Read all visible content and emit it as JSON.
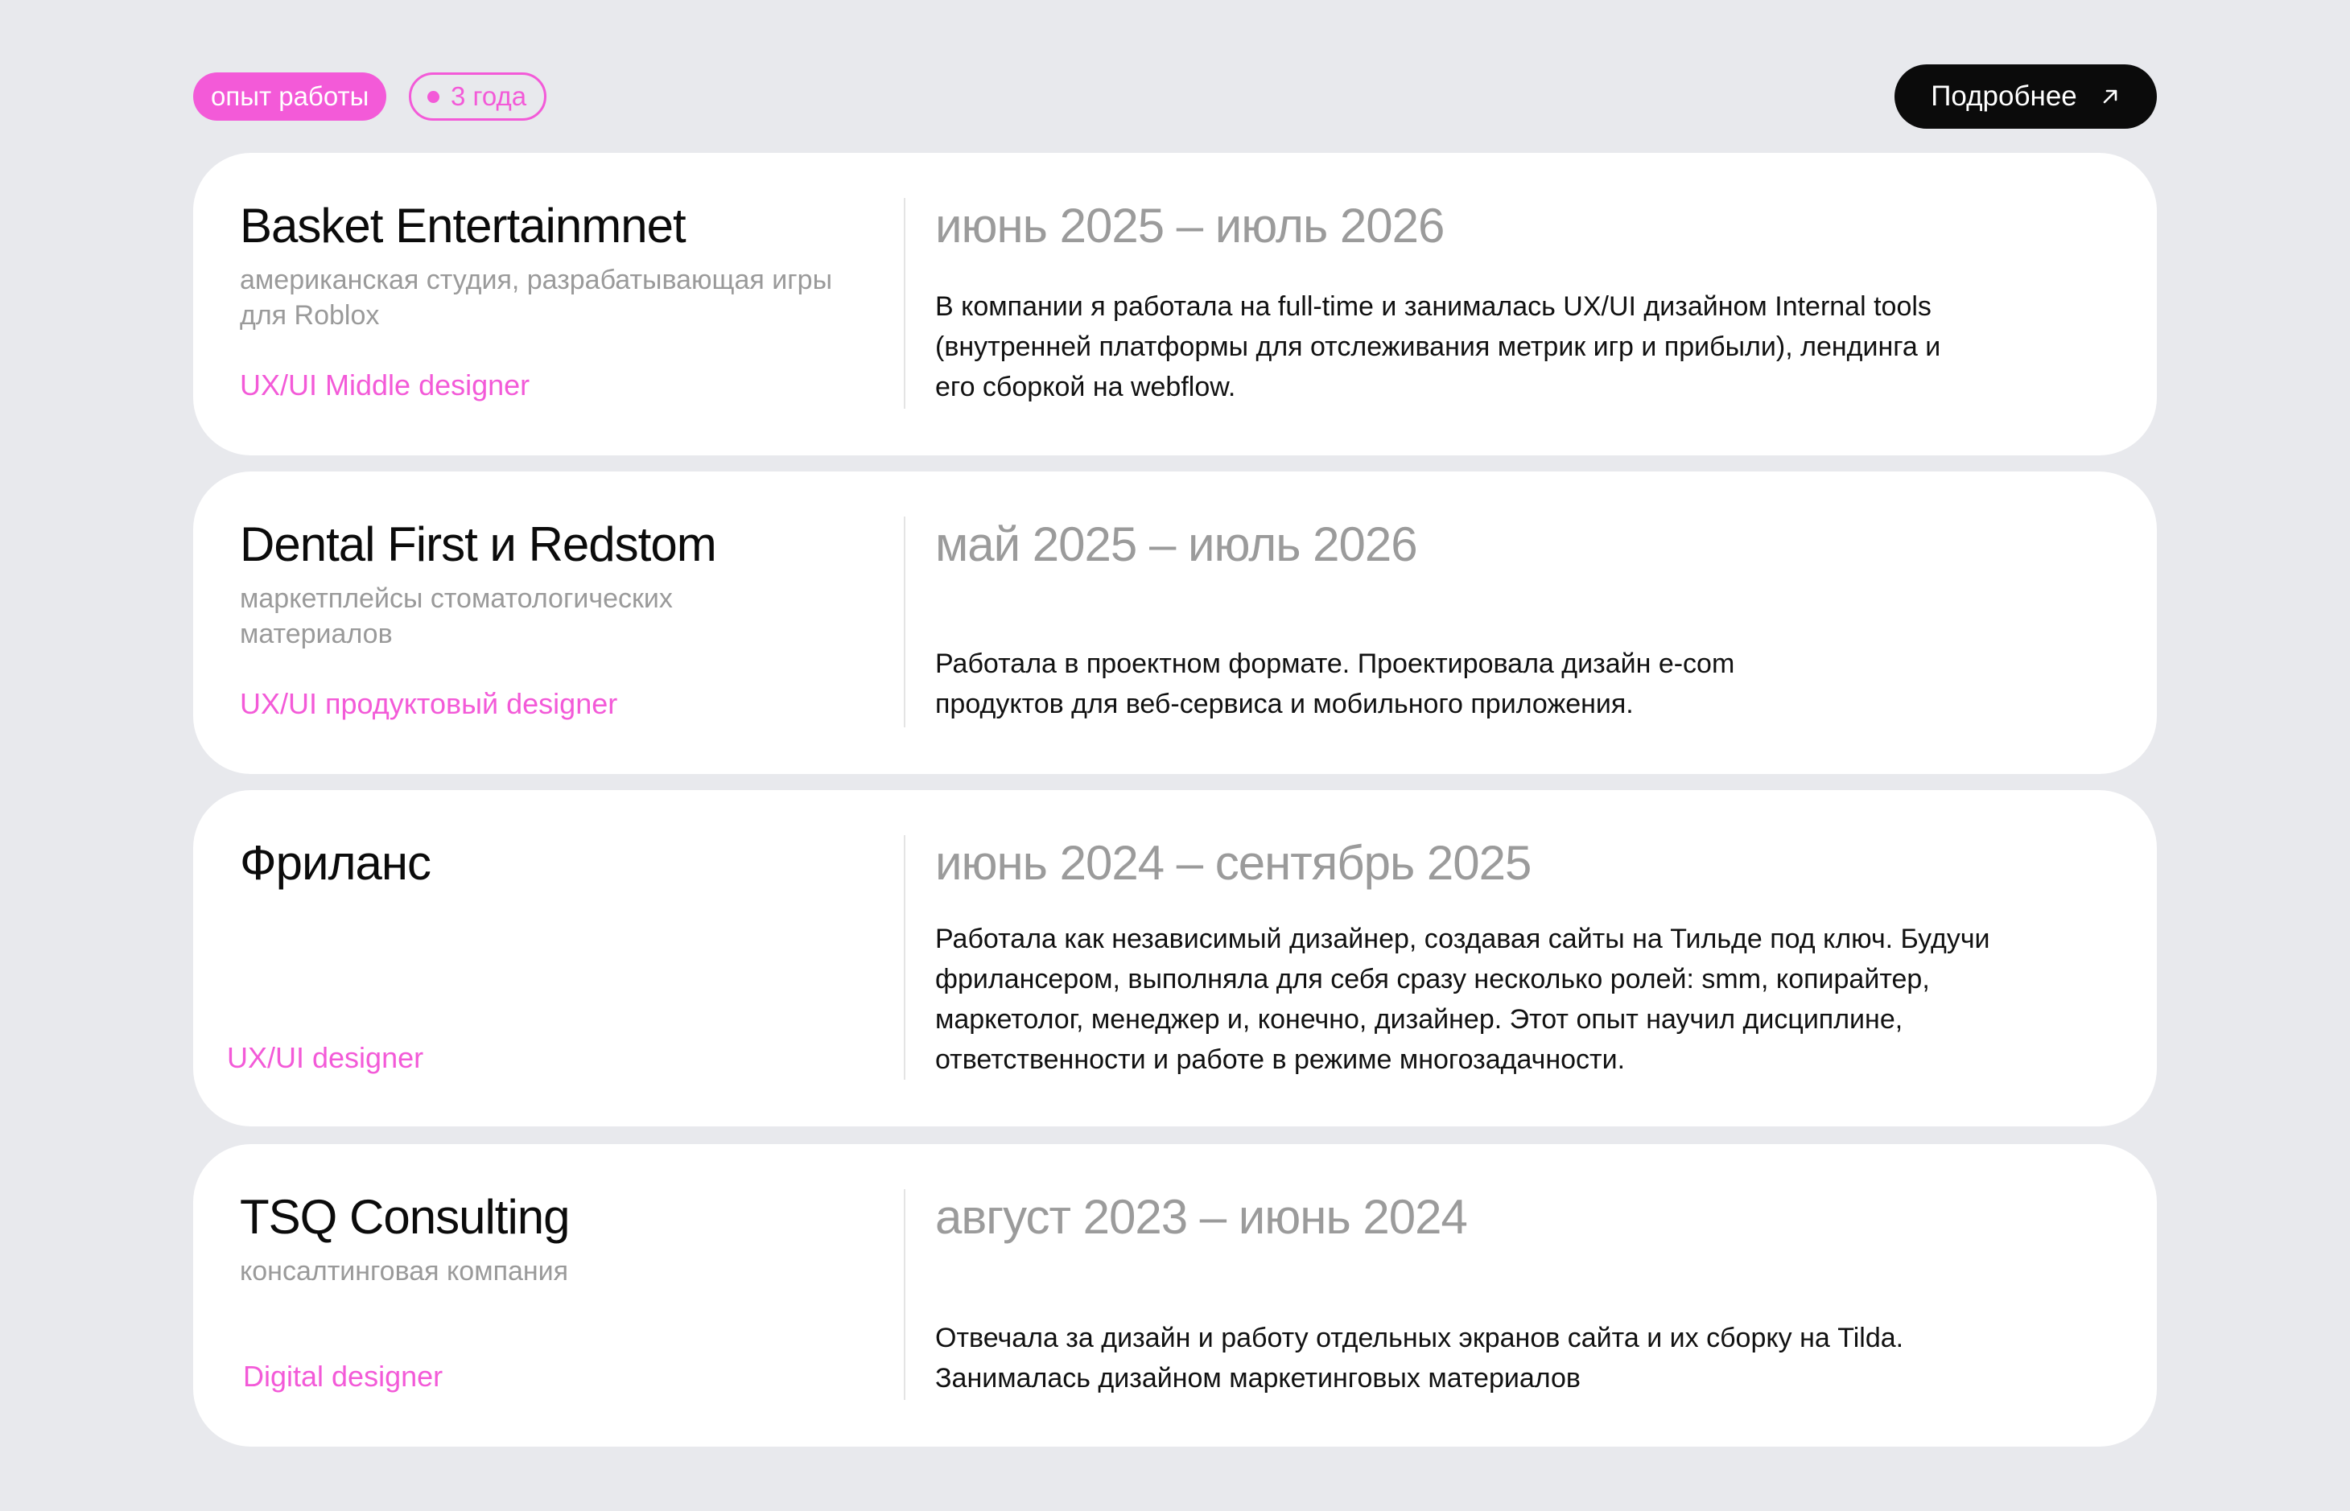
{
  "header": {
    "section_tag": "опыт работы",
    "duration_tag": "3 года",
    "more_button": "Подробнее",
    "more_icon": "arrow-up-right-icon"
  },
  "colors": {
    "accent": "#f35ad8",
    "background": "#e8e9ed",
    "card": "#ffffff",
    "muted": "#9b9b9b",
    "button": "#0b0b0b"
  },
  "jobs": [
    {
      "company": "Basket Entertainmnet",
      "subtitle": "американская студия, разрабатывающая игры для Roblox",
      "role": "UX/UI Middle designer",
      "period": "июнь 2025 – июль 2026",
      "description": "В компании я работала на full-time и занималась UX/UI дизайном Internal tools (внутренней платформы для отслеживания метрик игр и прибыли), лендинга и его сборкой на webflow."
    },
    {
      "company": "Dental First и Redstom",
      "subtitle": "маркетплейсы стоматологических материалов",
      "role": "UX/UI продуктовый designer",
      "period": "май 2025 – июль 2026",
      "description": "Работала в проектном формате. Проектировала дизайн e-com продуктов для веб-сервиса и мобильного приложения."
    },
    {
      "company": "Фриланс",
      "subtitle": "",
      "role": "UX/UI designer",
      "period": "июнь 2024 – сентябрь 2025",
      "description": "Работала как независимый дизайнер, создавая сайты на Тильде под ключ. Будучи фрилансером, выполняла для себя сразу несколько ролей: smm, копирайтер, маркетолог, менеджер и, конечно, дизайнер. Этот опыт научил дисциплине, ответственности и работе в режиме многозадачности."
    },
    {
      "company": "TSQ Consulting",
      "subtitle": "консалтинговая компания",
      "role": "Digital designer",
      "period": "август 2023 – июнь 2024",
      "description": "Отвечала за дизайн и работу отдельных экранов сайта и их сборку на Tilda. Занималась дизайном маркетинговых материалов"
    }
  ]
}
